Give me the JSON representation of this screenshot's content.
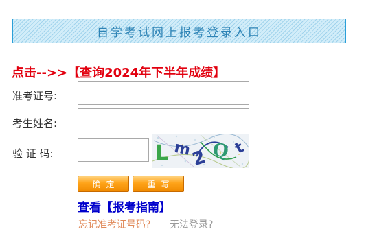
{
  "banner": {
    "title": "自学考试网上报考登录入口"
  },
  "notice": {
    "text": "点击-->>【查询2024年下半年成绩】"
  },
  "form": {
    "exam_id_label": "准考证号:",
    "exam_id_value": "",
    "name_label": "考生姓名:",
    "name_value": "",
    "captcha_label": "验 证 码:",
    "captcha_value": "",
    "captcha_text": "Lm2Qt"
  },
  "buttons": {
    "confirm": "确定",
    "reset": "重写"
  },
  "links": {
    "guide": "查看【报考指南】",
    "forgot_id": "忘记准考证号码?",
    "cannot_login": "无法登录?"
  },
  "colors": {
    "notice": "#e2000f",
    "guide": "#0000cc",
    "button": "#f5a21a",
    "banner_border": "#2a9fd8"
  }
}
